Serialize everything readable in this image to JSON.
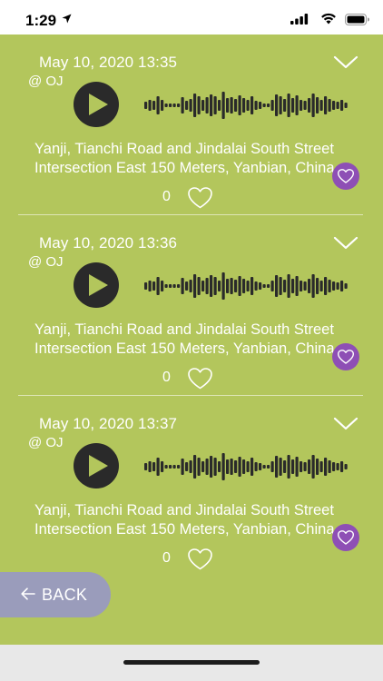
{
  "status_bar": {
    "time": "1:29"
  },
  "recordings": [
    {
      "date": "May 10, 2020 13:35",
      "user": "@ OJ",
      "address_line1": "Yanji, Tianchi Road and Jindalai South Street",
      "address_line2": "Intersection East 150 Meters, Yanbian, China",
      "likes": "0"
    },
    {
      "date": "May 10, 2020 13:36",
      "user": "@ OJ",
      "address_line1": "Yanji, Tianchi Road and Jindalai South Street",
      "address_line2": "Intersection East 150 Meters, Yanbian, China",
      "likes": "0"
    },
    {
      "date": "May 10, 2020 13:37",
      "user": "@ OJ",
      "address_line1": "Yanji, Tianchi Road and Jindalai South Street",
      "address_line2": "Intersection East 150 Meters, Yanbian, China",
      "likes": "0"
    }
  ],
  "back_button": {
    "label": "BACK",
    "icon": "arrow-left-icon"
  },
  "colors": {
    "background": "#b3c65c",
    "play_button": "#2a2a2a",
    "favorite_badge": "#8e4fb5",
    "back_button": "#9a9cbb"
  }
}
